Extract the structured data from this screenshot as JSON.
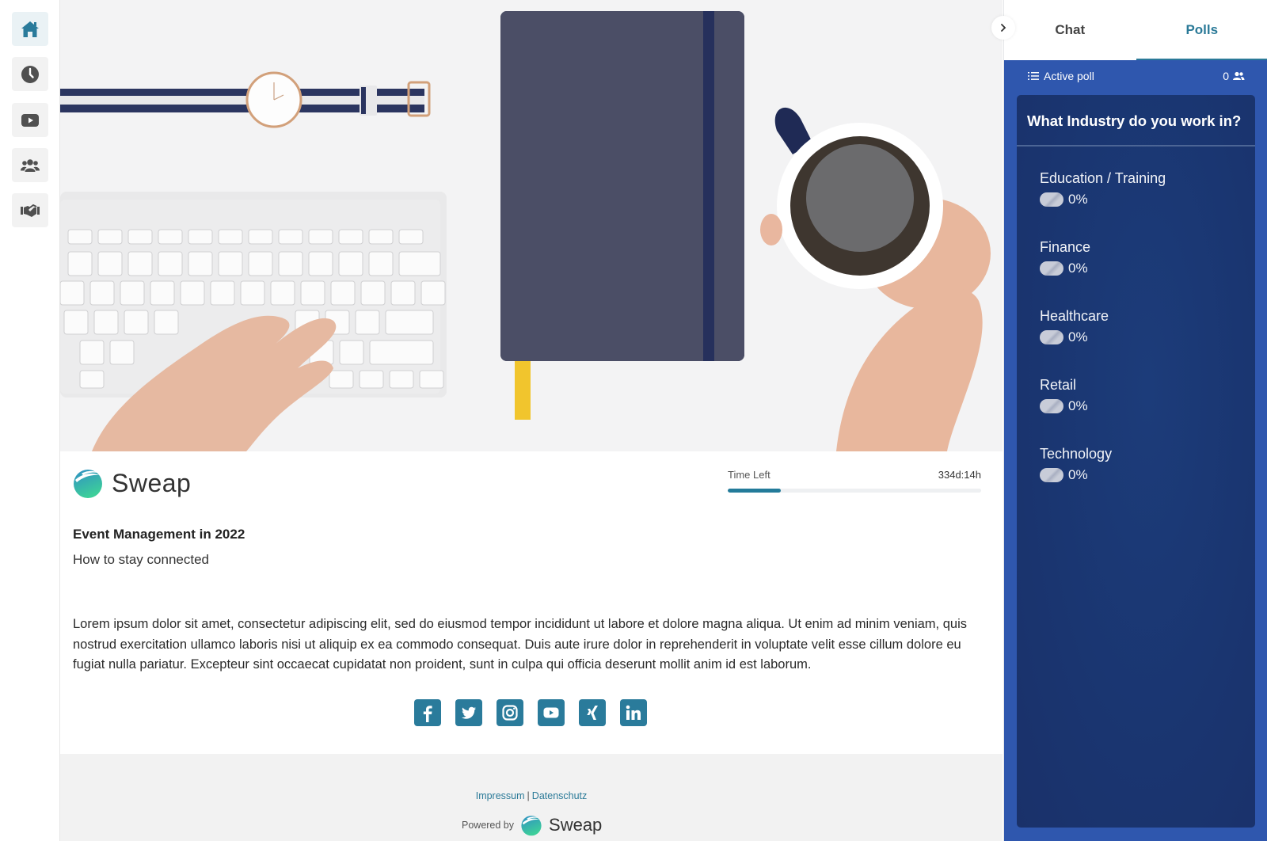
{
  "sidebar": {
    "items": [
      {
        "name": "home",
        "icon": "home-icon",
        "active": true
      },
      {
        "name": "agenda",
        "icon": "clock-icon",
        "active": false
      },
      {
        "name": "videos",
        "icon": "play-icon",
        "active": false
      },
      {
        "name": "attendees",
        "icon": "users-icon",
        "active": false
      },
      {
        "name": "sponsors",
        "icon": "handshake-icon",
        "active": false
      }
    ]
  },
  "hero": {
    "description": "Desk photo: watch, keyboard, notebook and coffee cup"
  },
  "event": {
    "brand": "Sweap",
    "time_left_label": "Time Left",
    "time_left_value": "334d:14h",
    "time_progress_percent": 21,
    "title": "Event Management in 2022",
    "subtitle": "How to stay connected",
    "description": "Lorem ipsum dolor sit amet, consectetur adipiscing elit, sed do eiusmod tempor incididunt ut labore et dolore magna aliqua. Ut enim ad minim veniam, quis nostrud exercitation ullamco laboris nisi ut aliquip ex ea commodo consequat. Duis aute irure dolor in reprehenderit in voluptate velit esse cillum dolore eu fugiat nulla pariatur. Excepteur sint occaecat cupidatat non proident, sunt in culpa qui officia deserunt mollit anim id est laborum."
  },
  "socials": [
    "facebook",
    "twitter",
    "instagram",
    "youtube",
    "xing",
    "linkedin"
  ],
  "footer": {
    "impressum": "Impressum",
    "separator": "|",
    "datenschutz": "Datenschutz",
    "powered_by": "Powered by",
    "brand": "Sweap"
  },
  "panel": {
    "collapse_icon": "chevron-right-icon",
    "tabs": [
      {
        "label": "Chat",
        "active": false
      },
      {
        "label": "Polls",
        "active": true
      }
    ],
    "poll": {
      "status_label": "Active poll",
      "participants": "0",
      "question": "What Industry do you work in?",
      "options": [
        {
          "label": "Education / Training",
          "percent": "0%"
        },
        {
          "label": "Finance",
          "percent": "0%"
        },
        {
          "label": "Healthcare",
          "percent": "0%"
        },
        {
          "label": "Retail",
          "percent": "0%"
        },
        {
          "label": "Technology",
          "percent": "0%"
        }
      ]
    }
  },
  "colors": {
    "accent": "#2b7a98",
    "panel_bg": "#2f57ae",
    "poll_card_bg": "#1b3774"
  }
}
